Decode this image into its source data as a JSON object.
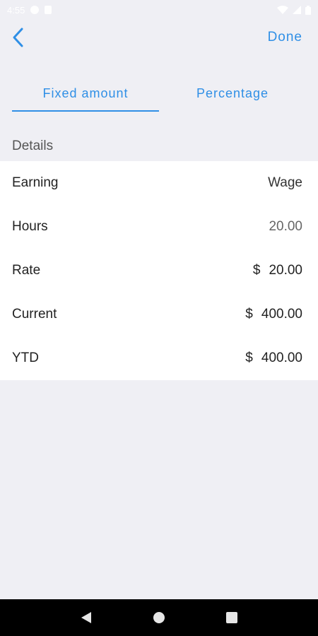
{
  "status_bar": {
    "time": "4:55"
  },
  "header": {
    "done_label": "Done"
  },
  "tabs": [
    {
      "label": "Fixed amount",
      "selected": true
    },
    {
      "label": "Percentage",
      "selected": false
    }
  ],
  "details": {
    "section_title": "Details",
    "rows": [
      {
        "label": "Earning",
        "currency": "",
        "value": "Wage"
      },
      {
        "label": "Hours",
        "currency": "",
        "value": "20.00"
      },
      {
        "label": "Rate",
        "currency": "$",
        "value": "20.00"
      },
      {
        "label": "Current",
        "currency": "$",
        "value": "400.00"
      },
      {
        "label": "YTD",
        "currency": "$",
        "value": "400.00"
      }
    ]
  },
  "colors": {
    "accent": "#2f8fe6",
    "background": "#efeff4",
    "card": "#ffffff",
    "navbar": "#000000"
  },
  "icons": {
    "back": "chevron-left-icon",
    "nav_back": "triangle-back-icon",
    "nav_home": "circle-home-icon",
    "nav_recent": "square-recents-icon"
  }
}
